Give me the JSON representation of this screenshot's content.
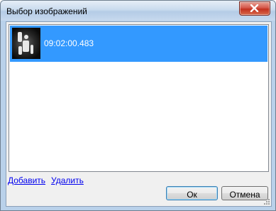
{
  "window": {
    "title": "Выбор изображений"
  },
  "image_list": {
    "items": [
      {
        "time": "09:02:00.483",
        "selected": true
      }
    ]
  },
  "links": {
    "add_label": "Добавить",
    "remove_label": "Удалить"
  },
  "buttons": {
    "ok_label": "Ок",
    "cancel_label": "Отмена"
  },
  "colors": {
    "selection": "#3399ff",
    "link": "#0000ee",
    "close_button": "#c2311f"
  },
  "icons": {
    "close": "close-icon",
    "thumbnail": "image-thumbnail"
  }
}
